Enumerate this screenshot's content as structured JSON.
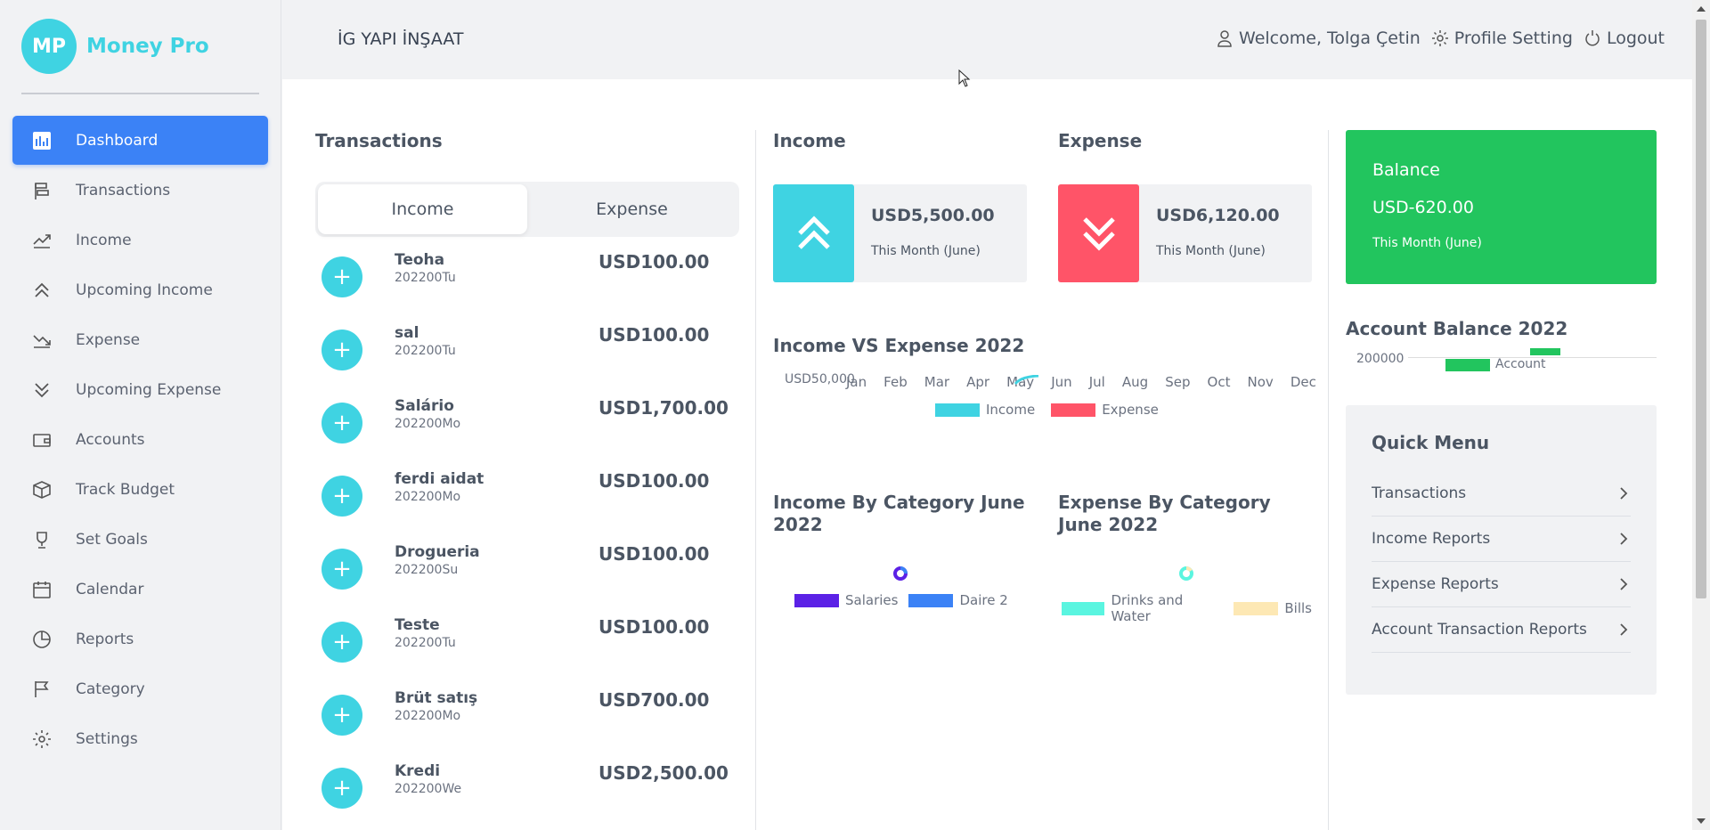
{
  "brand": {
    "logo_initials": "MP",
    "name": "Money Pro"
  },
  "sidebar": {
    "items": [
      {
        "label": "Dashboard",
        "icon": "dashboard-icon",
        "active": true
      },
      {
        "label": "Transactions",
        "icon": "transactions-icon"
      },
      {
        "label": "Income",
        "icon": "income-trend-icon"
      },
      {
        "label": "Upcoming Income",
        "icon": "double-chevron-up-icon"
      },
      {
        "label": "Expense",
        "icon": "expense-trend-icon"
      },
      {
        "label": "Upcoming Expense",
        "icon": "double-chevron-down-icon"
      },
      {
        "label": "Accounts",
        "icon": "wallet-icon"
      },
      {
        "label": "Track Budget",
        "icon": "box-icon"
      },
      {
        "label": "Set Goals",
        "icon": "trophy-icon"
      },
      {
        "label": "Calendar",
        "icon": "calendar-icon"
      },
      {
        "label": "Reports",
        "icon": "pie-chart-icon"
      },
      {
        "label": "Category",
        "icon": "flag-icon"
      },
      {
        "label": "Settings",
        "icon": "gear-icon"
      }
    ]
  },
  "header": {
    "company": "İG YAPI İNŞAAT",
    "welcome": "Welcome, Tolga Çetin",
    "profile_setting": "Profile Setting",
    "logout": "Logout"
  },
  "transactions": {
    "title": "Transactions",
    "tabs": [
      "Income",
      "Expense"
    ],
    "active_tab": "Income",
    "rows": [
      {
        "name": "Teoha",
        "date": "202200Tu",
        "amount": "USD100.00"
      },
      {
        "name": "sal",
        "date": "202200Tu",
        "amount": "USD100.00"
      },
      {
        "name": "Salário",
        "date": "202200Mo",
        "amount": "USD1,700.00"
      },
      {
        "name": "ferdi aidat",
        "date": "202200Mo",
        "amount": "USD100.00"
      },
      {
        "name": "Drogueria",
        "date": "202200Su",
        "amount": "USD100.00"
      },
      {
        "name": "Teste",
        "date": "202200Tu",
        "amount": "USD100.00"
      },
      {
        "name": "Brüt satış",
        "date": "202200Mo",
        "amount": "USD700.00"
      },
      {
        "name": "Kredi",
        "date": "202200We",
        "amount": "USD2,500.00"
      }
    ]
  },
  "income_card": {
    "title": "Income",
    "value": "USD5,500.00",
    "sub": "This Month (June)",
    "color": "#3fd3e2"
  },
  "expense_card": {
    "title": "Expense",
    "value": "USD6,120.00",
    "sub": "This Month (June)",
    "color": "#ff5468"
  },
  "balance_card": {
    "title": "Balance",
    "value": "USD-620.00",
    "sub": "This Month (June)",
    "color": "#22c55e"
  },
  "income_vs_expense": {
    "title": "Income VS Expense 2022",
    "y_tick": "USD50,000",
    "months": [
      "Jan",
      "Feb",
      "Mar",
      "Apr",
      "May",
      "Jun",
      "Jul",
      "Aug",
      "Sep",
      "Oct",
      "Nov",
      "Dec"
    ],
    "legend": [
      {
        "label": "Income",
        "color": "#3fd3e2"
      },
      {
        "label": "Expense",
        "color": "#ff5468"
      }
    ]
  },
  "income_by_category": {
    "title": "Income By Category June 2022",
    "legend": [
      {
        "label": "Salaries",
        "color": "#5b21e6"
      },
      {
        "label": "Daire 2",
        "color": "#3b82f6"
      }
    ]
  },
  "expense_by_category": {
    "title": "Expense By Category June 2022",
    "legend": [
      {
        "label": "Drinks and Water",
        "color": "#5af5e0"
      },
      {
        "label": "Bills",
        "color": "#fde8b4"
      }
    ]
  },
  "account_balance": {
    "title": "Account Balance 2022",
    "y_tick": "200000",
    "legend_label": "Account"
  },
  "quick_menu": {
    "title": "Quick Menu",
    "items": [
      "Transactions",
      "Income Reports",
      "Expense Reports",
      "Account Transaction Reports"
    ]
  }
}
